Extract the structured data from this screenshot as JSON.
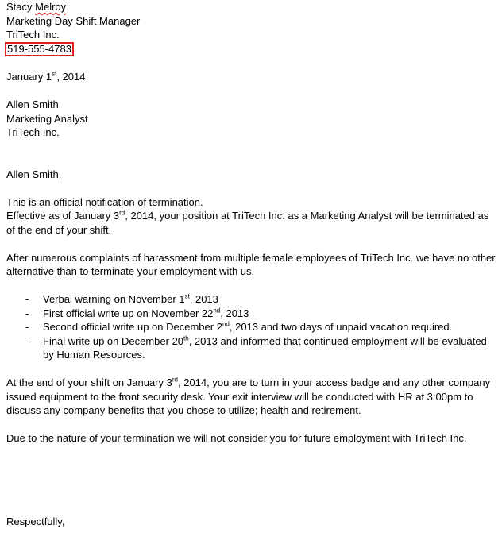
{
  "sender": {
    "first_name": "Stacy",
    "last_name": "Melroy",
    "title": "Marketing Day Shift Manager",
    "company": "TriTech Inc.",
    "phone": "519-555-4783"
  },
  "date": {
    "prefix": "January 1",
    "suffix": "st",
    "year": ", 2014"
  },
  "recipient": {
    "name": "Allen Smith",
    "title": "Marketing Analyst",
    "company": "TriTech Inc."
  },
  "salutation": "Allen Smith,",
  "para1": {
    "line1": "This is an official notification of termination.",
    "effective_a": "Effective as of January 3",
    "effective_sup": "rd",
    "effective_b": ", 2014, your position at TriTech Inc. as a Marketing Analyst will be terminated as of the end of your shift."
  },
  "para2": "After numerous complaints of harassment from multiple female employees of TriTech Inc. we have no other alternative than to terminate your employment with us.",
  "warnings": [
    {
      "a": "Verbal warning on November 1",
      "sup": "st",
      "b": ", 2013"
    },
    {
      "a": "First official write up on November 22",
      "sup": "nd",
      "b": ", 2013"
    },
    {
      "a": "Second official write up on December 2",
      "sup": "nd",
      "b": ", 2013 and two days of unpaid vacation required."
    },
    {
      "a": "Final write up on December 20",
      "sup": "th",
      "b": ", 2013 and informed that continued employment will be evaluated by Human Resources."
    }
  ],
  "para3": {
    "a": "At the end of your shift on January 3",
    "sup": "rd",
    "b": ", 2014, you are to turn in your access badge and any other company issued equipment to the front security desk. Your exit interview will be conducted with HR at 3:00pm to discuss any company benefits that you chose to utilize; health and retirement."
  },
  "para4": "Due to the nature of your termination we will not consider you for future employment with TriTech Inc.",
  "closing": "Respectfully,"
}
